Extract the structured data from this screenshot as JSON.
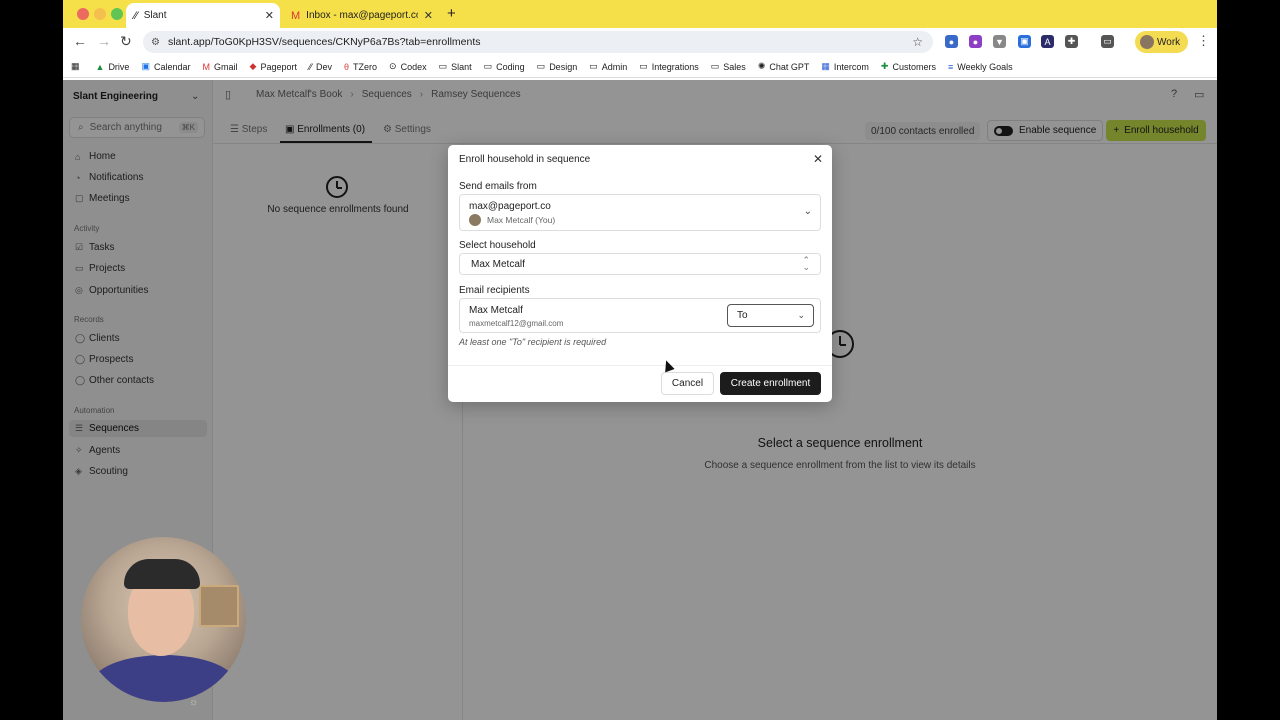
{
  "browser": {
    "tabs": [
      {
        "label": "Slant",
        "active": true
      },
      {
        "label": "Inbox - max@pageport.co - P",
        "active": false
      }
    ],
    "url": "slant.app/ToG0KpH3SV/sequences/CKNyP6a7Bs?tab=enrollments",
    "profile_label": "Work",
    "bookmarks": [
      "Drive",
      "Calendar",
      "Gmail",
      "Pageport",
      "Dev",
      "TZero",
      "Codex",
      "Slant",
      "Coding",
      "Design",
      "Admin",
      "Integrations",
      "Sales",
      "Chat GPT",
      "Intercom",
      "Customers",
      "Weekly Goals"
    ]
  },
  "sidebar": {
    "workspace": "Slant Engineering",
    "search_placeholder": "Search anything",
    "search_shortcut": "⌘K",
    "items_top": [
      {
        "label": "Home",
        "icon": "home-icon"
      },
      {
        "label": "Notifications",
        "icon": "bell-icon"
      },
      {
        "label": "Meetings",
        "icon": "calendar-icon"
      }
    ],
    "sections": [
      {
        "title": "Activity",
        "items": [
          "Tasks",
          "Projects",
          "Opportunities"
        ]
      },
      {
        "title": "Records",
        "items": [
          "Clients",
          "Prospects",
          "Other contacts"
        ]
      },
      {
        "title": "Automation",
        "items": [
          "Sequences",
          "Agents",
          "Scouting"
        ]
      }
    ],
    "active_item": "Sequences"
  },
  "header": {
    "breadcrumbs": [
      "Max Metcalf's Book",
      "Sequences",
      "Ramsey Sequences"
    ]
  },
  "tabs": [
    {
      "label": "Steps"
    },
    {
      "label": "Enrollments (0)"
    },
    {
      "label": "Settings"
    }
  ],
  "toolbar": {
    "enrolled_text": "0/100 contacts enrolled",
    "enable_label": "Enable sequence",
    "enroll_button": "Enroll household"
  },
  "list": {
    "empty_text": "No sequence enrollments found"
  },
  "detail": {
    "title": "Select a sequence enrollment",
    "subtitle": "Choose a sequence enrollment from the list to view its details"
  },
  "dialog": {
    "title": "Enroll household in sequence",
    "from_label": "Send emails from",
    "from_email": "max@pageport.co",
    "from_name": "Max Metcalf (You)",
    "household_label": "Select household",
    "household_value": "Max Metcalf",
    "recipients_label": "Email recipients",
    "recipient_name": "Max Metcalf",
    "recipient_email": "maxmetcalf12@gmail.com",
    "recipient_type": "To",
    "note": "At least one \"To\" recipient is required",
    "cancel_label": "Cancel",
    "create_label": "Create enrollment"
  },
  "colors": {
    "tabstrip": "#f6e04a",
    "accent_button": "#c8e64b",
    "primary_dark": "#1c1c1c"
  }
}
